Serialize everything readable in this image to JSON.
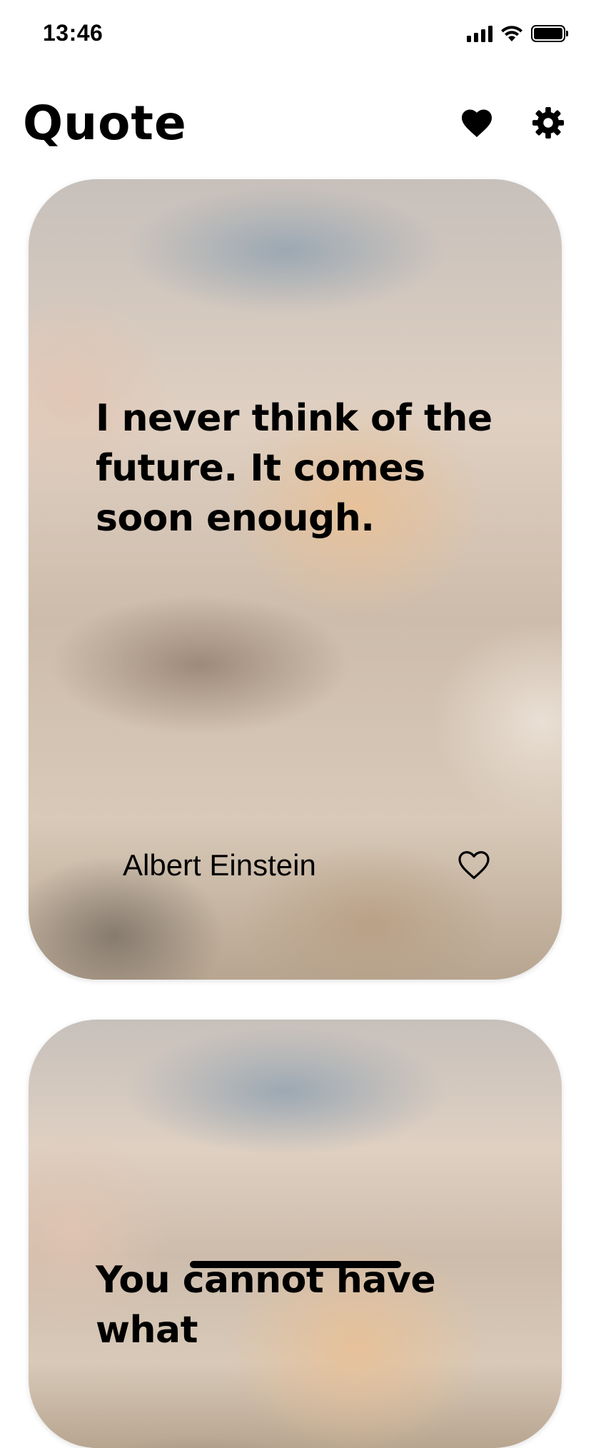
{
  "status_bar": {
    "time": "13:46",
    "icons": [
      "cellular-signal-icon",
      "wifi-icon",
      "battery-icon"
    ]
  },
  "header": {
    "title": "Quote",
    "favorites_icon": "heart-filled-icon",
    "settings_icon": "gear-icon"
  },
  "quotes": [
    {
      "text": "I never think of the future. It comes soon enough.",
      "author": "Albert Einstein",
      "favorite_icon": "heart-outline-icon"
    },
    {
      "text": "You cannot have what"
    }
  ],
  "colors": {
    "background": "#ffffff",
    "text": "#000000"
  }
}
